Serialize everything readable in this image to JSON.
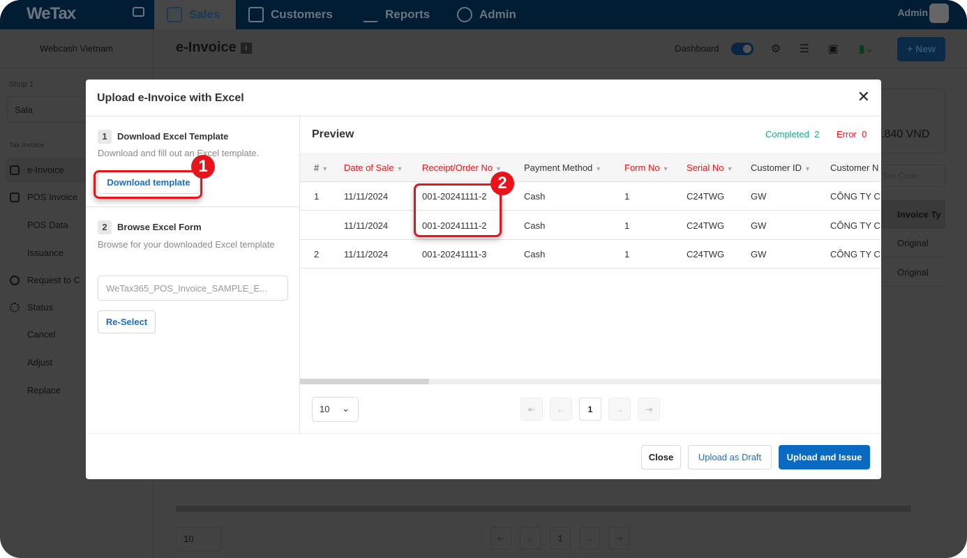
{
  "app": {
    "logo": "WeTax",
    "user": "Admin"
  },
  "nav": {
    "tabs": [
      {
        "label": "Sales",
        "active": true
      },
      {
        "label": "Customers"
      },
      {
        "label": "Reports"
      },
      {
        "label": "Admin"
      }
    ]
  },
  "header": {
    "company": "Webcash Vietnam",
    "title": "e-Invoice",
    "dashboard_label": "Dashboard",
    "dashboard_on": true,
    "new_label": "+ New"
  },
  "sidebar": {
    "shop_label": "Shop",
    "shop_count": "1",
    "shop_value": "Sala",
    "section": "Tax Invoice",
    "items": [
      {
        "label": "e-Invoice",
        "active": true
      },
      {
        "label": "POS Invoice"
      },
      {
        "label": "POS Data"
      },
      {
        "label": "Issuance"
      },
      {
        "label": "Request to C"
      },
      {
        "label": "Status"
      },
      {
        "label": "Cancel"
      },
      {
        "label": "Adjust"
      },
      {
        "label": "Replace"
      }
    ]
  },
  "background": {
    "amount": ".840 VND",
    "tax_code_placeholder": "Tax Code",
    "col_header": "Invoice Ty",
    "rows": [
      "Original",
      "Original"
    ],
    "page_size": "10",
    "page": "1"
  },
  "modal": {
    "title": "Upload e-Invoice with Excel",
    "step1": {
      "num": "1",
      "title": "Download Excel Template",
      "desc": "Download and fill out an Excel template.",
      "button": "Download template"
    },
    "step2": {
      "num": "2",
      "title": "Browse Excel Form",
      "desc": "Browse for your downloaded Excel template",
      "file": "WeTax365_POS_Invoice_SAMPLE_E...",
      "button": "Re-Select"
    },
    "preview": {
      "title": "Preview",
      "completed_label": "Completed",
      "completed": "2",
      "error_label": "Error",
      "error": "0",
      "columns": [
        "#",
        "Date of Sale",
        "Receipt/Order No",
        "Payment Method",
        "Form No",
        "Serial No",
        "Customer ID",
        "Customer N"
      ],
      "rows": [
        [
          "1",
          "11/11/2024",
          "001-20241111-2",
          "Cash",
          "1",
          "C24TWG",
          "GW",
          "CÔNG TY C"
        ],
        [
          "",
          "11/11/2024",
          "001-20241111-2",
          "Cash",
          "1",
          "C24TWG",
          "GW",
          "CÔNG TY C"
        ],
        [
          "2",
          "11/11/2024",
          "001-20241111-3",
          "Cash",
          "1",
          "C24TWG",
          "GW",
          "CÔNG TY C"
        ]
      ],
      "page_size": "10",
      "page": "1"
    },
    "footer": {
      "close": "Close",
      "draft": "Upload as Draft",
      "issue": "Upload and Issue"
    }
  },
  "annotations": [
    "1",
    "2"
  ],
  "colors": {
    "accent": "#1a6fc4",
    "primary_button": "#0a6ac2",
    "required": "#e8141c",
    "completed": "#19a88f",
    "annotation": "#e8141c",
    "overlay": "#424242"
  }
}
